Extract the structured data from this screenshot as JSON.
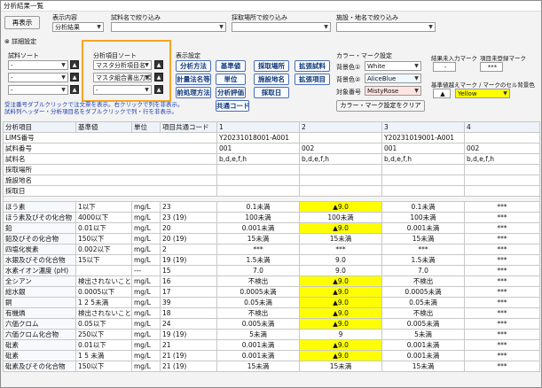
{
  "window": {
    "title": "分析結果一覧"
  },
  "toolbar": {
    "redisplay": "再表示",
    "display_label": "表示内容",
    "display_value": "分析結果",
    "sample_filter_label": "試料名で絞り込み",
    "place_filter_label": "採取場所で絞り込み",
    "facility_filter_label": "施設・地名で絞り込み"
  },
  "detail": {
    "label": "詳細設定"
  },
  "sample_sort": {
    "label": "試料ソート",
    "rows": [
      "-",
      "-",
      "-"
    ]
  },
  "analysis_sort": {
    "label": "分析項目ソート",
    "rows": [
      "マスタ分析項目名",
      "マスタ組合書出力順",
      "-"
    ]
  },
  "display_settings": {
    "label": "表示設定",
    "buttons": [
      "分析方法",
      "基準値",
      "採取場所",
      "拡張試料",
      "計量法名等",
      "単位",
      "施設地名",
      "拡張項目",
      "前処理方法",
      "分析評価",
      "採取日",
      "共通コード"
    ]
  },
  "color_settings": {
    "label": "カラー・マーク設定",
    "bg1_label": "背景色①",
    "bg1_value": "White",
    "bg2_label": "背景色②",
    "bg2_value": "AliceBlue",
    "target_label": "対象番号",
    "target_value": "MistyRose",
    "clear": "カラー・マーク設定をクリア"
  },
  "marks": {
    "unentered_label": "結果未入力マーク",
    "unentered_value": "-",
    "unregistered_label": "項目未登録マーク",
    "unregistered_value": "***",
    "exceed_label": "基準値越えマーク / マークのセル背景色",
    "exceed_mark": "▲",
    "exceed_color": "Yellow"
  },
  "notes": [
    "受注番号ダブルクリックで注文票を表示。右クリックで列を非表示。",
    "試料列ヘッダー・分析項目名をダブルクリックで列・行を非表示。"
  ],
  "table": {
    "headers": [
      "分析項目",
      "基準値",
      "単位",
      "項目共通コード",
      "1",
      "2",
      "3",
      "4"
    ],
    "info_rows": [
      {
        "label": "LIMS番号",
        "c1": "Y20231018001-A001",
        "c2": "",
        "c3": "Y20231019001-A001",
        "c4": ""
      },
      {
        "label": "試料番号",
        "c1": "001",
        "c2": "002",
        "c3": "001",
        "c4": "002"
      },
      {
        "label": "試料名",
        "c1": "b,d,e,f,h",
        "c2": "b,d,e,f,h",
        "c3": "b,d,e,f,h",
        "c4": "b,d,e,f,h"
      },
      {
        "label": "採取場所",
        "c1": "",
        "c2": "",
        "c3": "",
        "c4": ""
      },
      {
        "label": "施設地名",
        "c1": "",
        "c2": "",
        "c3": "",
        "c4": ""
      },
      {
        "label": "採取日",
        "c1": "",
        "c2": "",
        "c3": "",
        "c4": ""
      }
    ],
    "rows": [
      {
        "name": "ほう素",
        "std": "1以下",
        "unit": "mg/L",
        "code": "23",
        "v": [
          "0.1未満",
          "▲9.0",
          "0.1未満",
          "***"
        ],
        "hl": [
          false,
          true,
          false,
          false
        ]
      },
      {
        "name": "ほう素及びその化合物",
        "std": "4000以下",
        "unit": "mg/L",
        "code": "23 (19)",
        "v": [
          "100未満",
          "100未満",
          "100未満",
          "***"
        ],
        "hl": [
          false,
          false,
          false,
          false
        ]
      },
      {
        "name": "鉛",
        "std": "0.01以下",
        "unit": "mg/L",
        "code": "20",
        "v": [
          "0.001未満",
          "▲9.0",
          "0.001未満",
          "***"
        ],
        "hl": [
          false,
          true,
          false,
          false
        ]
      },
      {
        "name": "鉛及びその化合物",
        "std": "150以下",
        "unit": "mg/L",
        "code": "20 (19)",
        "v": [
          "15未満",
          "15未満",
          "15未満",
          "***"
        ],
        "hl": [
          false,
          false,
          false,
          false
        ]
      },
      {
        "name": "四塩化炭素",
        "std": "0.002以下",
        "unit": "mg/L",
        "code": "2",
        "v": [
          "***",
          "***",
          "***",
          "***"
        ],
        "hl": [
          false,
          false,
          false,
          false
        ]
      },
      {
        "name": "水銀及びその化合物",
        "std": "15以下",
        "unit": "mg/L",
        "code": "19 (19)",
        "v": [
          "1.5未満",
          "9.0",
          "1.5未満",
          "***"
        ],
        "hl": [
          false,
          false,
          false,
          false
        ]
      },
      {
        "name": "水素イオン濃度 (pH)",
        "std": "",
        "unit": "---",
        "code": "15",
        "v": [
          "7.0",
          "9.0",
          "7.0",
          "***"
        ],
        "hl": [
          false,
          false,
          false,
          false
        ]
      },
      {
        "name": "全シアン",
        "std": "検出されないこと",
        "unit": "mg/L",
        "code": "16",
        "v": [
          "不検出",
          "▲9.0",
          "不検出",
          "***"
        ],
        "hl": [
          false,
          true,
          false,
          false
        ]
      },
      {
        "name": "総水銀",
        "std": "0.0005以下",
        "unit": "mg/L",
        "code": "17",
        "v": [
          "0.0005未満",
          "▲9.0",
          "0.0005未満",
          "***"
        ],
        "hl": [
          false,
          true,
          false,
          false
        ]
      },
      {
        "name": "銅",
        "std": "1 2 5未満",
        "unit": "mg/L",
        "code": "39",
        "v": [
          "0.05未満",
          "▲9.0",
          "0.05未満",
          "***"
        ],
        "hl": [
          false,
          true,
          false,
          false
        ]
      },
      {
        "name": "有機燐",
        "std": "検出されないこと",
        "unit": "mg/L",
        "code": "18",
        "v": [
          "不検出",
          "▲9.0",
          "不検出",
          "***"
        ],
        "hl": [
          false,
          true,
          false,
          false
        ]
      },
      {
        "name": "六価クロム",
        "std": "0.05以下",
        "unit": "mg/L",
        "code": "24",
        "v": [
          "0.005未満",
          "▲9.0",
          "0.005未満",
          "***"
        ],
        "hl": [
          false,
          true,
          false,
          false
        ]
      },
      {
        "name": "六価クロム化合物",
        "std": "250以下",
        "unit": "mg/L",
        "code": "19 (19)",
        "v": [
          "5未満",
          "9",
          "5未満",
          "***"
        ],
        "hl": [
          false,
          false,
          false,
          false
        ]
      },
      {
        "name": "砒素",
        "std": "0.01以下",
        "unit": "mg/L",
        "code": "21",
        "v": [
          "0.001未満",
          "▲9.0",
          "0.001未満",
          "***"
        ],
        "hl": [
          false,
          true,
          false,
          false
        ]
      },
      {
        "name": "砒素",
        "std": "1 5 未満",
        "unit": "mg/L",
        "code": "21 (19)",
        "v": [
          "0.001未満",
          "▲9.0",
          "0.001未満",
          "***"
        ],
        "hl": [
          false,
          true,
          false,
          false
        ]
      },
      {
        "name": "砒素及びその化合物",
        "std": "150以下",
        "unit": "mg/L",
        "code": "21 (19)",
        "v": [
          "15未満",
          "15未満",
          "15未満",
          "***"
        ],
        "hl": [
          false,
          false,
          false,
          false
        ]
      }
    ]
  }
}
